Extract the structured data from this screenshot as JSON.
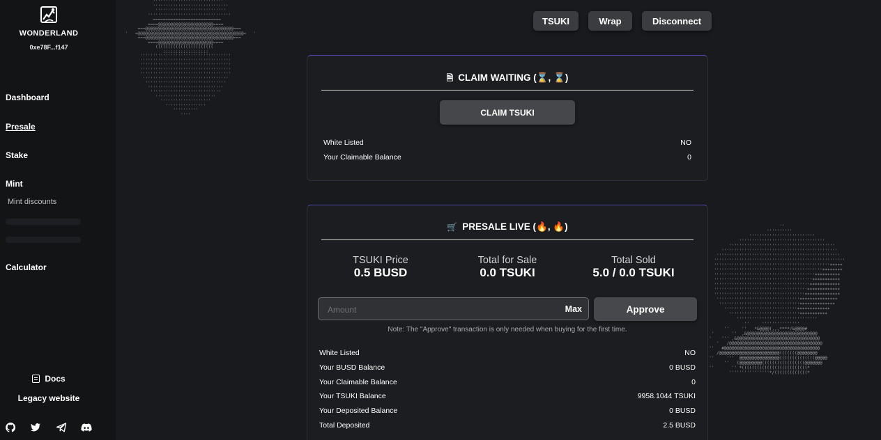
{
  "sidebar": {
    "brand": "WONDERLAND",
    "wallet": "0xe78F...f147",
    "nav": {
      "dashboard": "Dashboard",
      "presale": "Presale",
      "stake": "Stake",
      "mint": "Mint",
      "mint_discounts": "Mint discounts",
      "calculator": "Calculator"
    },
    "docs": "Docs",
    "legacy": "Legacy website",
    "social_icons": [
      "github-icon",
      "twitter-icon",
      "telegram-icon",
      "discord-icon"
    ]
  },
  "topbar": {
    "token_label": "TSUKI",
    "wrap_label": "Wrap",
    "disconnect_label": "Disconnect"
  },
  "claim": {
    "title": "CLAIM WAITING (⌛, ⌛)",
    "button": "CLAIM TSUKI",
    "rows": [
      {
        "label": "White Listed",
        "value": "NO"
      },
      {
        "label": "Your Claimable Balance",
        "value": "0"
      }
    ]
  },
  "presale": {
    "title": "PRESALE LIVE (🔥, 🔥)",
    "stats": [
      {
        "label": "TSUKI Price",
        "value": "0.5 BUSD"
      },
      {
        "label": "Total for Sale",
        "value": "0.0 TSUKI"
      },
      {
        "label": "Total Sold",
        "value": "5.0 / 0.0 TSUKI"
      }
    ],
    "amount_placeholder": "Amount",
    "max_label": "Max",
    "approve_label": "Approve",
    "note": "Note: The \"Approve\" transaction is only needed when buying for the first time.",
    "rows": [
      {
        "label": "White Listed",
        "value": "NO"
      },
      {
        "label": "Your BUSD Balance",
        "value": "0 BUSD"
      },
      {
        "label": "Your Claimable Balance",
        "value": "0"
      },
      {
        "label": "Your TSUKI Balance",
        "value": "9958.1044 TSUKI"
      },
      {
        "label": "Your Deposited Balance",
        "value": "0 BUSD"
      },
      {
        "label": "Total Deposited",
        "value": "2.5 BUSD"
      }
    ]
  },
  "colors": {
    "background": "#181a1d",
    "sidebar": "#131416",
    "card": "#1b1d21",
    "card_accent": "#4b46a8",
    "button": "#3a3c40"
  }
}
